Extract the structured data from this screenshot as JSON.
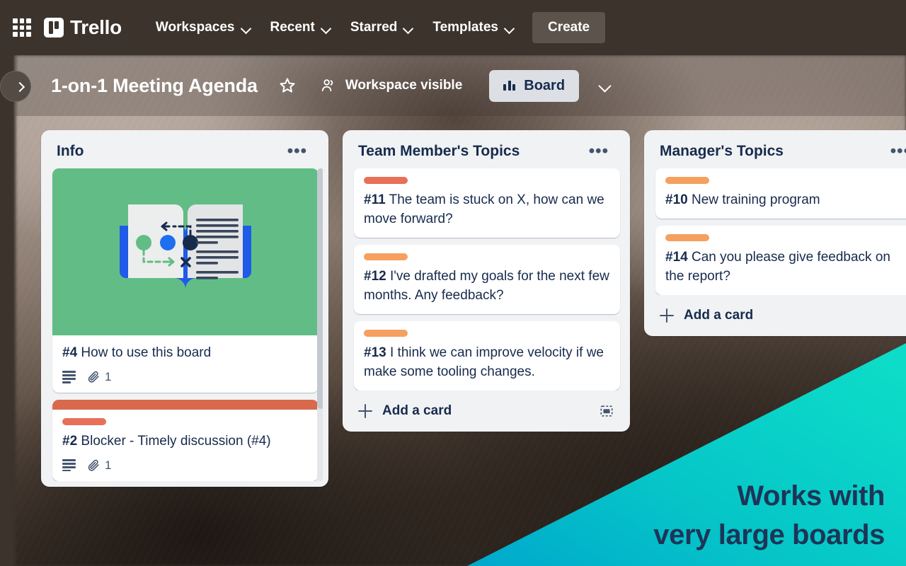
{
  "topnav": {
    "apps_icon": "grid-apps-icon",
    "brand": "Trello",
    "items": [
      {
        "label": "Workspaces",
        "icon": "chevron-down-icon"
      },
      {
        "label": "Recent",
        "icon": "chevron-down-icon"
      },
      {
        "label": "Starred",
        "icon": "chevron-down-icon"
      },
      {
        "label": "Templates",
        "icon": "chevron-down-icon"
      }
    ],
    "create_label": "Create"
  },
  "board_header": {
    "sidebar_toggle_icon": "chevron-right-icon",
    "title": "1-on-1 Meeting Agenda",
    "star_icon": "star-outline-icon",
    "visibility_icon": "people-icon",
    "visibility_label": "Workspace visible",
    "view_icon": "board-view-icon",
    "view_label": "Board",
    "view_caret_icon": "chevron-down-icon"
  },
  "colors": {
    "nav_bg": "#3b332c",
    "list_bg": "#f1f2f4",
    "card_bg": "#ffffff",
    "text_primary": "#172b4d",
    "text_muted": "#44546f",
    "label_red": "#e8705a",
    "label_orange": "#f5a05f",
    "cover_red": "#d9694c",
    "cover_green": "#61bd85",
    "promo_teal": "#0ad8c8",
    "promo_cyan": "#00b0c8",
    "promo_text": "#1d3557"
  },
  "lists": [
    {
      "title": "Info",
      "menu_icon": "list-actions-icon",
      "has_scrollbar": true,
      "cards": [
        {
          "id": "#4",
          "text": "How to use this board",
          "cover_type": "image",
          "cover_image": "open-book-illustration",
          "badges": {
            "description_icon": "description-icon",
            "attachment_icon": "attachment-icon",
            "attachment_count": "1"
          }
        },
        {
          "id": "#2",
          "text": "Blocker - Timely discussion (#4)",
          "cover_type": "color",
          "cover_color": "#d9694c",
          "label": "#e8705a",
          "badges": {
            "description_icon": "description-icon",
            "attachment_icon": "attachment-icon",
            "attachment_count": "1"
          }
        }
      ]
    },
    {
      "title": "Team Member's Topics",
      "menu_icon": "list-actions-icon",
      "has_scrollbar": false,
      "cards": [
        {
          "id": "#11",
          "text": "The team is stuck on X, how can we move forward?",
          "label": "#e8705a"
        },
        {
          "id": "#12",
          "text": "I've drafted my goals for the next few months. Any feedback?",
          "label": "#f5a05f"
        },
        {
          "id": "#13",
          "text": "I think we can improve velocity if we make some tooling changes.",
          "label": "#f5a05f"
        }
      ],
      "add_card_label": "Add a card",
      "add_card_icon": "plus-icon",
      "template_icon": "card-template-icon"
    },
    {
      "title": "Manager's Topics",
      "menu_icon": "list-actions-icon",
      "has_scrollbar": false,
      "cards": [
        {
          "id": "#10",
          "text": "New training program",
          "label": "#f5a05f"
        },
        {
          "id": "#14",
          "text": "Can you please give feedback on the report?",
          "label": "#f5a05f"
        }
      ],
      "add_card_label": "Add a card",
      "add_card_icon": "plus-icon"
    }
  ],
  "promo": {
    "line1": "Works with",
    "line2": "very large boards"
  }
}
